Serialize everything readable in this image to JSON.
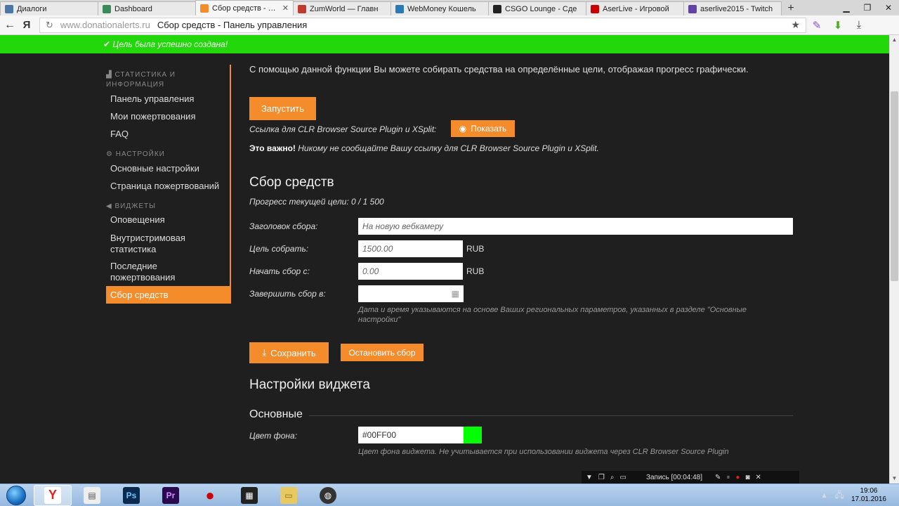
{
  "browser": {
    "tabs": [
      {
        "label": "Диалоги",
        "color": "#4a76a8",
        "active": false
      },
      {
        "label": "Dashboard",
        "color": "#3a8a5a",
        "active": false
      },
      {
        "label": "Сбор средств - Пан",
        "color": "#f48c2c",
        "active": true
      },
      {
        "label": "ZumWorld — Главн",
        "color": "#c0392b",
        "active": false
      },
      {
        "label": "WebMoney Кошель",
        "color": "#2a7ab8",
        "active": false
      },
      {
        "label": "CSGO Lounge - Сде",
        "color": "#222222",
        "active": false
      },
      {
        "label": "AserLive - Игровой",
        "color": "#cc0000",
        "active": false
      },
      {
        "label": "aserlive2015 - Twitch",
        "color": "#6441a5",
        "active": false
      }
    ],
    "new_tab": "+",
    "url_domain": "www.donationalerts.ru",
    "url_title": "Сбор средств - Панель управления",
    "yandex_glyph": "Я"
  },
  "notification": {
    "text": "Цель была успешно создана!",
    "color": "#22d80a"
  },
  "sidebar": {
    "sections": [
      {
        "heading": "Статистика и информация",
        "icon": "bar-chart-icon",
        "items": [
          "Панель управления",
          "Мои пожертвования",
          "FAQ"
        ]
      },
      {
        "heading": "Настройки",
        "icon": "gear-icon",
        "items": [
          "Основные настройки",
          "Страница пожертвований"
        ]
      },
      {
        "heading": "Виджеты",
        "icon": "megaphone-icon",
        "items": [
          "Оповещения",
          "Внутристримовая статистика",
          "Последние пожертвования",
          "Сбор средств"
        ]
      }
    ],
    "active_item": "Сбор средств",
    "accent": "#f48c2c"
  },
  "main": {
    "intro": "С помощью данной функции Вы можете собирать средства на определённые цели, отображая прогресс графически.",
    "launch_button": "Запустить",
    "plugin_link_text": "Ссылка для CLR Browser Source Plugin и XSplit:",
    "show_button": "Показать",
    "warning_bold": "Это важно!",
    "warning_text": " Никому не сообщайте Вашу ссылку для CLR Browser Source Plugin и XSplit.",
    "section_title": "Сбор средств",
    "progress_text": "Прогресс текущей цели: 0 / 1 500",
    "form": {
      "title_label": "Заголовок сбора:",
      "title_value": "На новую вебкамеру",
      "goal_label": "Цель собрать:",
      "goal_value": "1500.00",
      "goal_unit": "RUB",
      "start_label": "Начать сбор с:",
      "start_value": "0.00",
      "start_unit": "RUB",
      "end_label": "Завершить сбор в:",
      "end_value": "",
      "hint": "Дата и время указываются на основе Ваших региональных параметров, указанных в разделе \"Основные настройки\""
    },
    "save_button": "Сохранить",
    "stop_button": "Остановить сбор",
    "widget_title": "Настройки виджета",
    "basic_title": "Основные",
    "bg_color_label": "Цвет фона:",
    "bg_color_value": "#00FF00",
    "bg_color_hint": "Цвет фона виджета. Не учитывается при использовании виджета через CLR Browser Source Plugin"
  },
  "recorder": {
    "label": "Запись [00:04:48]"
  },
  "taskbar": {
    "apps": [
      {
        "name": "yandex-browser",
        "glyph": "Y",
        "color": "#e02020"
      },
      {
        "name": "notepad",
        "glyph": "▤",
        "color": "#6a8fb5"
      },
      {
        "name": "photoshop",
        "glyph": "Ps",
        "color": "#0a2a4f"
      },
      {
        "name": "premiere",
        "glyph": "Pr",
        "color": "#2a0a4f"
      },
      {
        "name": "recorder",
        "glyph": "●",
        "color": "#cc0000"
      },
      {
        "name": "video-editor",
        "glyph": "▦",
        "color": "#222222"
      },
      {
        "name": "explorer",
        "glyph": "▭",
        "color": "#d8b850"
      },
      {
        "name": "obs",
        "glyph": "◍",
        "color": "#333333"
      }
    ],
    "time": "19:06",
    "date": "17.01.2016"
  }
}
